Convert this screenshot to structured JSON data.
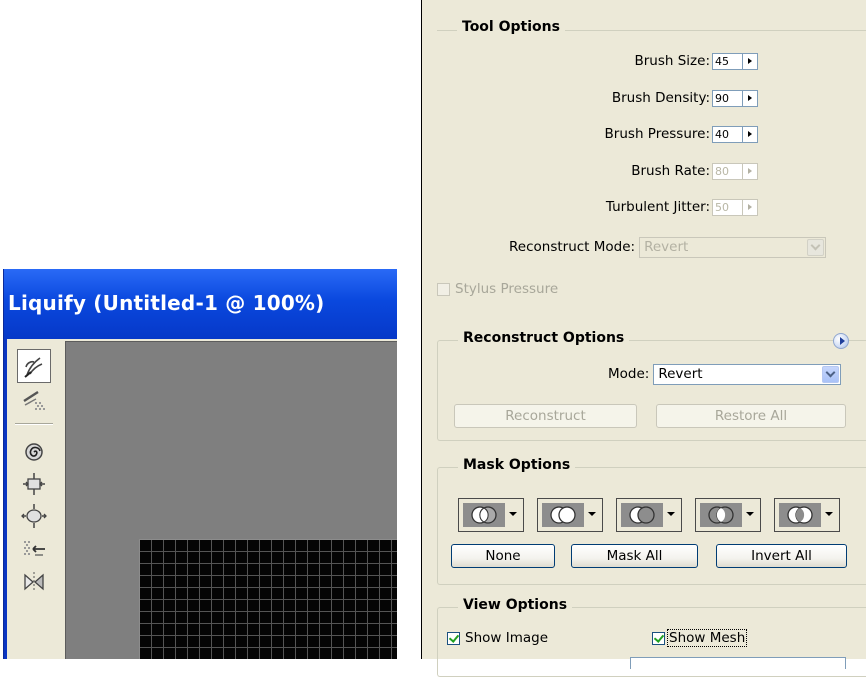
{
  "liquify": {
    "title": "Liquify (Untitled-1 @ 100%)",
    "tools": [
      {
        "icon": "forward-warp-tool-icon"
      },
      {
        "icon": "reconstruct-tool-icon"
      },
      {
        "icon": "twirl-tool-icon"
      },
      {
        "icon": "pucker-tool-icon"
      },
      {
        "icon": "bloat-tool-icon"
      },
      {
        "icon": "push-left-tool-icon"
      },
      {
        "icon": "mirror-tool-icon"
      }
    ]
  },
  "tool_options": {
    "title": "Tool Options",
    "brush_size": {
      "label": "Brush Size:",
      "value": "45"
    },
    "brush_density": {
      "label": "Brush Density:",
      "value": "90"
    },
    "brush_pressure": {
      "label": "Brush Pressure:",
      "value": "40"
    },
    "brush_rate": {
      "label": "Brush Rate:",
      "value": "80"
    },
    "turbulent_jitter": {
      "label": "Turbulent Jitter:",
      "value": "50"
    },
    "reconstruct_mode": {
      "label": "Reconstruct Mode:",
      "value": "Revert"
    },
    "stylus_pressure": {
      "label": "Stylus Pressure",
      "checked": false
    }
  },
  "reconstruct_options": {
    "title": "Reconstruct Options",
    "mode_label": "Mode:",
    "mode_value": "Revert",
    "reconstruct_button": "Reconstruct",
    "restore_all_button": "Restore All"
  },
  "mask_options": {
    "title": "Mask Options",
    "mask_modes": [
      "replace-selection-icon",
      "add-to-selection-icon",
      "subtract-from-selection-icon",
      "intersect-with-selection-icon",
      "invert-selection-icon"
    ],
    "none_button": "None",
    "mask_all_button": "Mask All",
    "invert_all_button": "Invert All"
  },
  "view_options": {
    "title": "View Options",
    "show_image": {
      "label": "Show Image",
      "checked": true
    },
    "show_mesh": {
      "label": "Show Mesh",
      "checked": true
    }
  },
  "colors": {
    "title_bar": "#0a48de",
    "panel_bg": "#ece9d8",
    "canvas_bg": "#7f7f7f",
    "mesh_bg": "#050505",
    "button_border": "#003c74"
  }
}
